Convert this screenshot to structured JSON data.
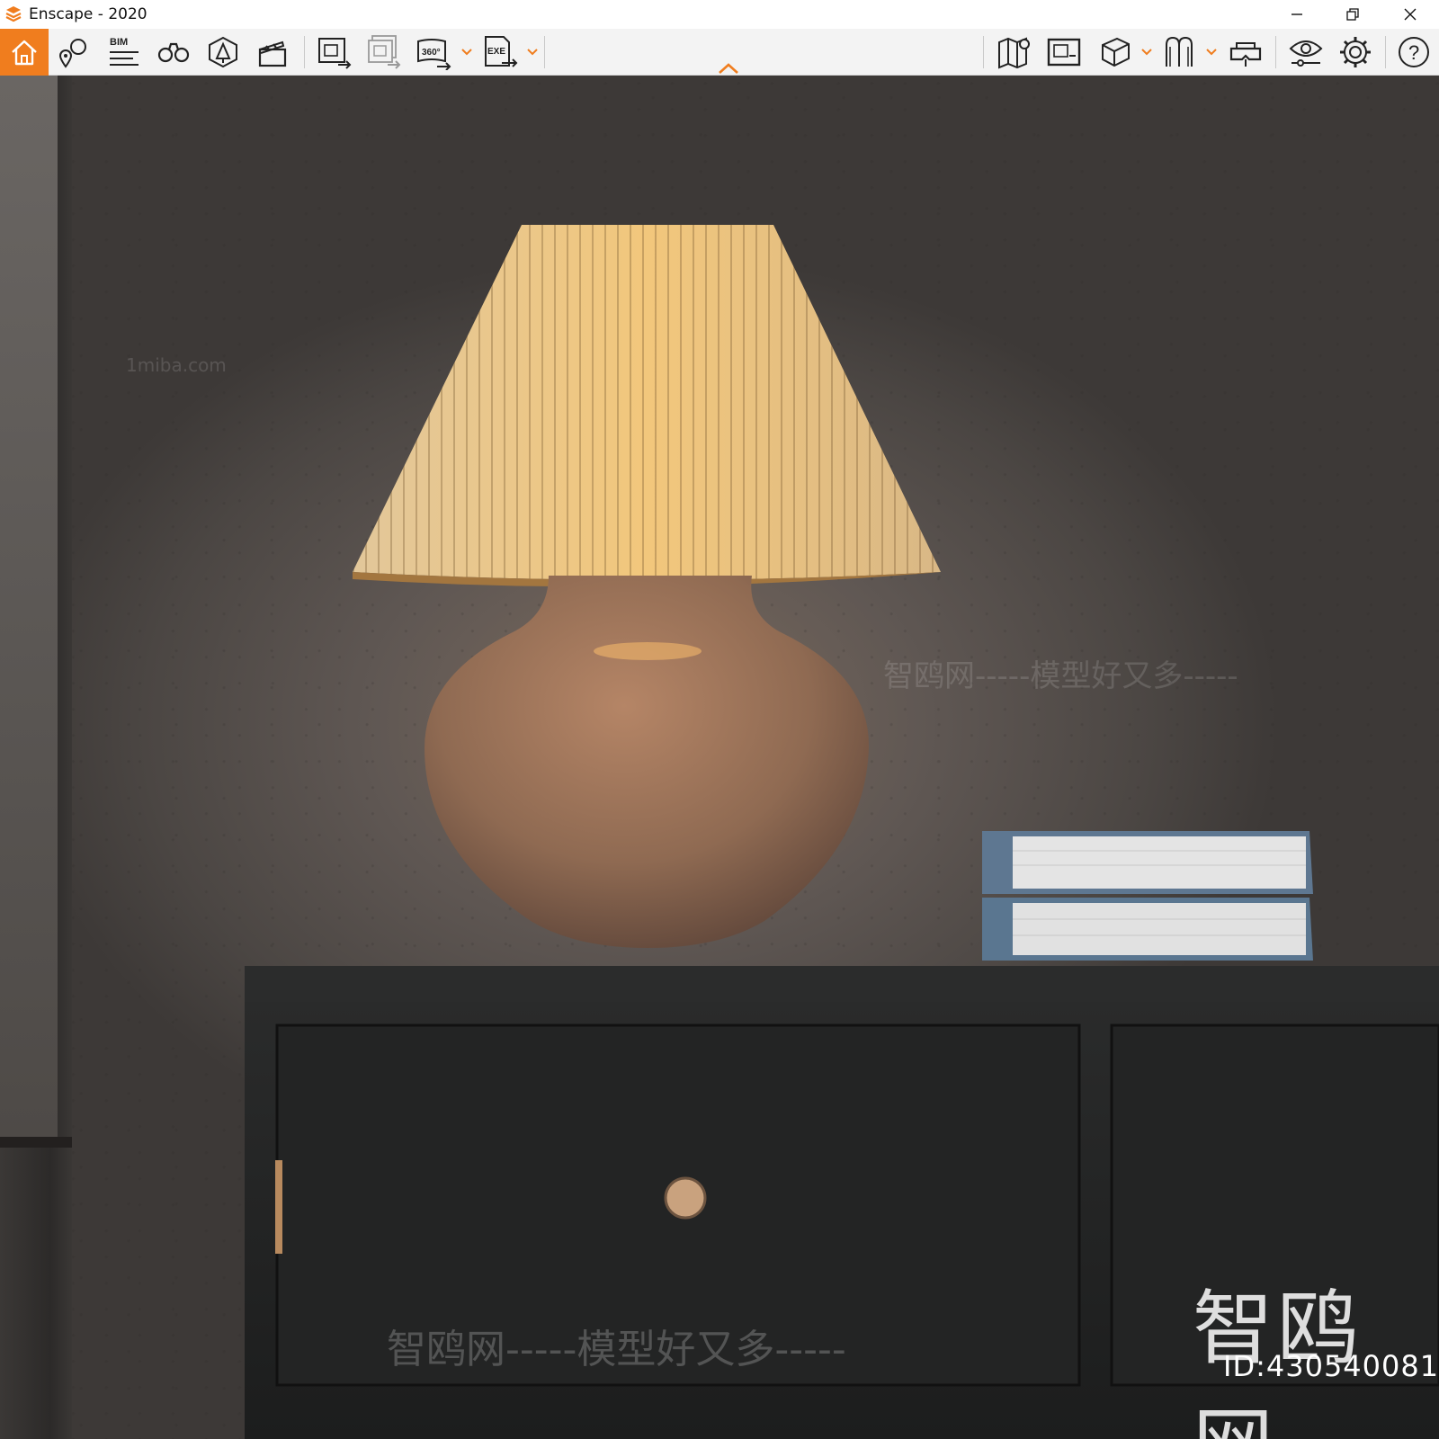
{
  "window": {
    "title": "Enscape - 2020",
    "minimize_glyph": "—",
    "restore_glyph": "❐",
    "close_glyph": "✕"
  },
  "toolbar": {
    "accent_color": "#f07d1e",
    "items": [
      {
        "name": "home-icon"
      },
      {
        "name": "view-management-icon"
      },
      {
        "name": "bim-icon",
        "label": "BIM"
      },
      {
        "name": "binoculars-icon"
      },
      {
        "name": "asset-library-icon"
      },
      {
        "name": "video-editor-icon"
      },
      {
        "name": "render-image-icon"
      },
      {
        "name": "batch-render-icon"
      },
      {
        "name": "panorama-360-icon",
        "label": "360°"
      },
      {
        "name": "export-exe-icon",
        "label": "EXE"
      },
      {
        "name": "map-icon"
      },
      {
        "name": "screenshot-icon"
      },
      {
        "name": "cube-icon"
      },
      {
        "name": "material-editor-icon"
      },
      {
        "name": "vr-headset-icon"
      },
      {
        "name": "visual-settings-icon"
      },
      {
        "name": "settings-gear-icon"
      },
      {
        "name": "help-icon",
        "label": "?"
      }
    ]
  },
  "viewport": {
    "scene": "table-lamp-on-black-cabinet",
    "watermark_main": "智鸥网",
    "watermark_id": "ID:430540081",
    "watermark_bottom": "智鸥网-----模型好又多-----",
    "watermark_mid": "智鸥网-----模型好又多-----",
    "watermark_site": "1miba.com"
  }
}
